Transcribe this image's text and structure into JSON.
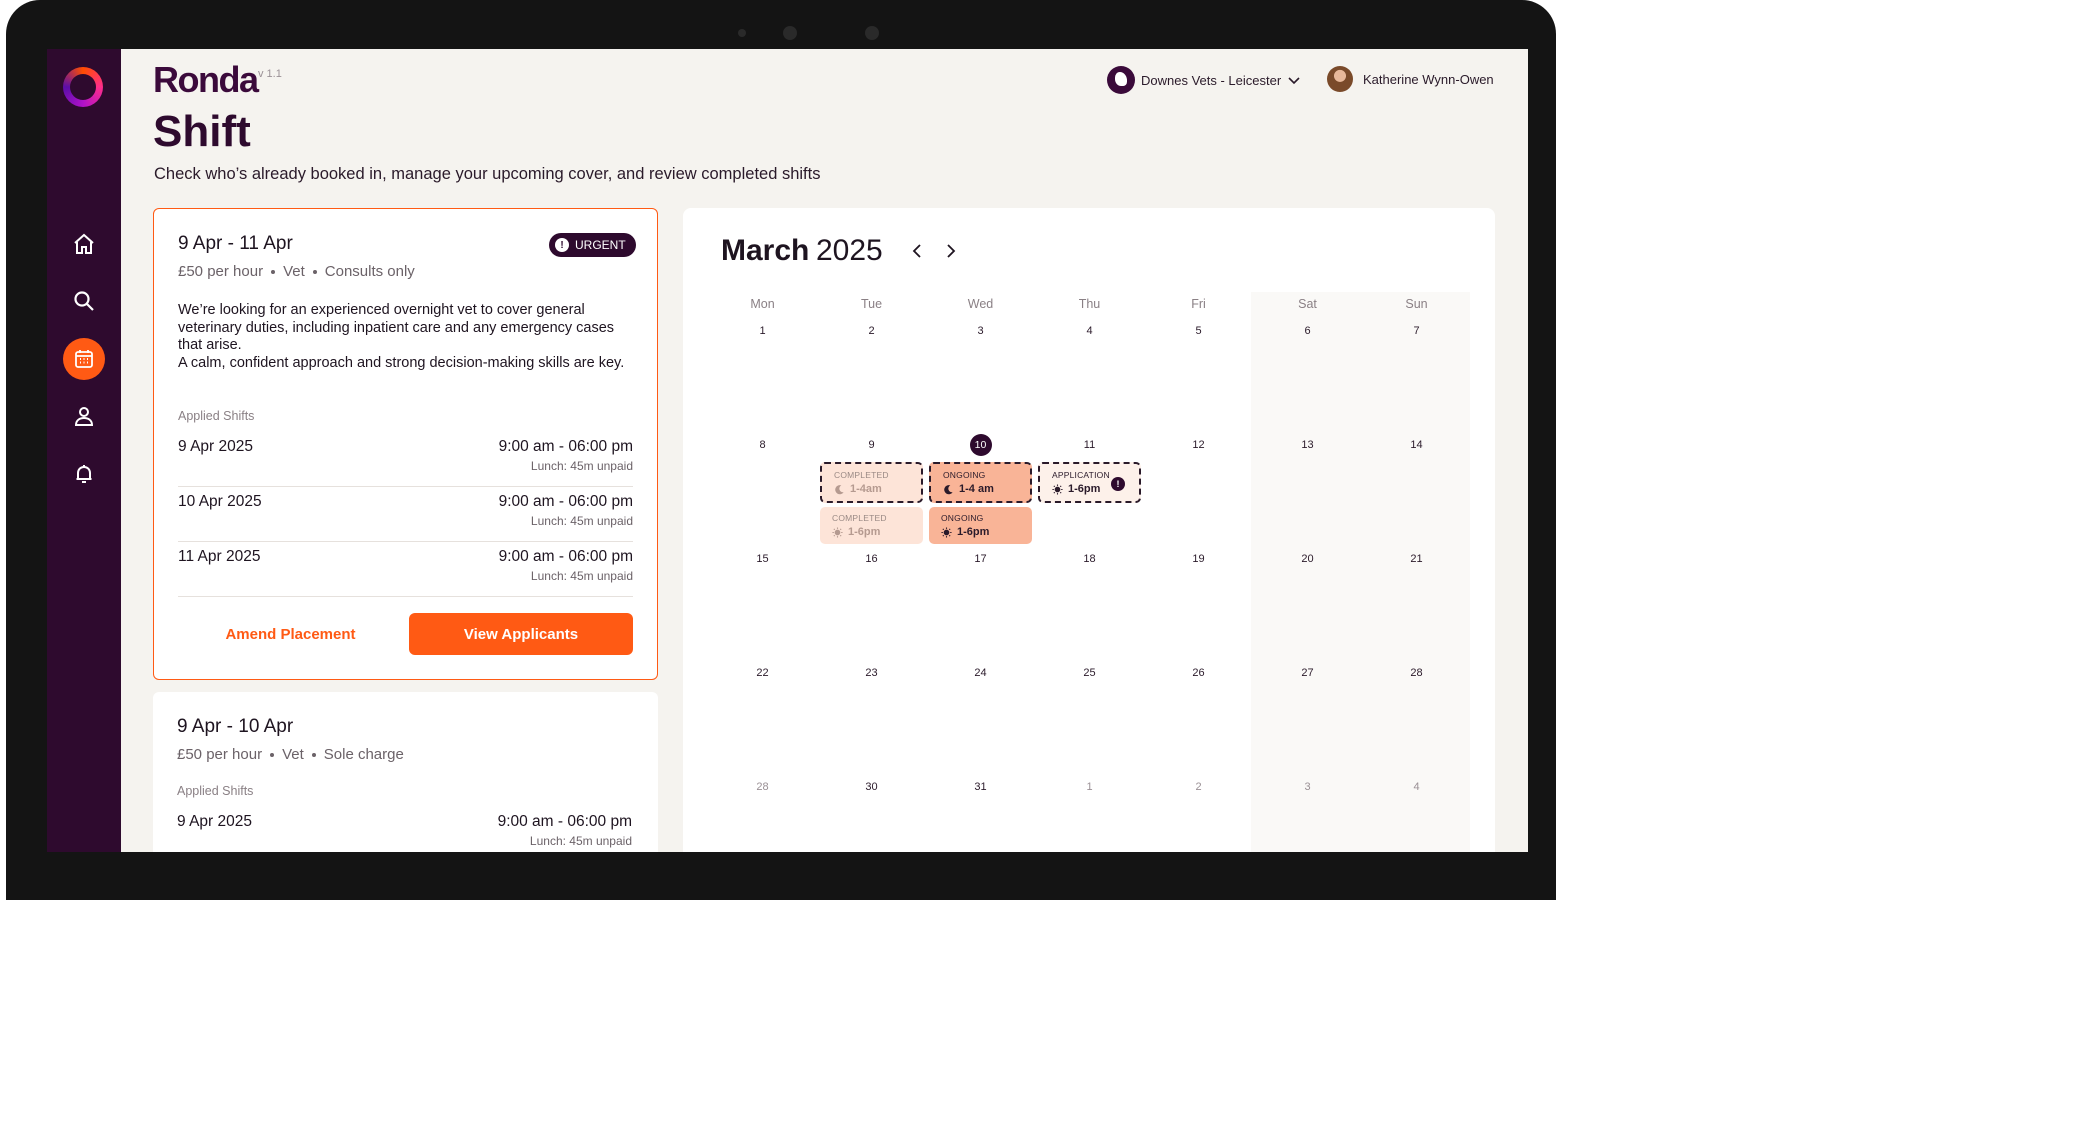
{
  "app": {
    "brand": "Ronda",
    "version": "v 1.1"
  },
  "header": {
    "org_name": "Downes Vets - Leicester",
    "user_name": "Katherine Wynn-Owen"
  },
  "page": {
    "title": "Shift",
    "subtitle": "Check who’s already booked in, manage your upcoming cover, and review completed shifts"
  },
  "sidebar": {
    "items": [
      {
        "icon": "home-icon",
        "active": false
      },
      {
        "icon": "search-icon",
        "active": false
      },
      {
        "icon": "calendar-icon",
        "active": true
      },
      {
        "icon": "user-icon",
        "active": false
      },
      {
        "icon": "bell-icon",
        "active": false
      }
    ]
  },
  "shifts": [
    {
      "title": "9 Apr - 11 Apr",
      "rate": "£50 per hour",
      "role": "Vet",
      "type": "Consults only",
      "badge": "URGENT",
      "description": "We’re looking for an experienced overnight vet to cover general veterinary duties, including inpatient care and any emergency cases that arise.\nA calm, confident approach and strong decision-making skills are key.",
      "applied_label": "Applied Shifts",
      "rows": [
        {
          "date": "9 Apr 2025",
          "time": "9:00 am - 06:00 pm",
          "lunch": "Lunch: 45m unpaid"
        },
        {
          "date": "10 Apr 2025",
          "time": "9:00 am - 06:00 pm",
          "lunch": "Lunch: 45m unpaid"
        },
        {
          "date": "11 Apr 2025",
          "time": "9:00 am - 06:00 pm",
          "lunch": "Lunch: 45m unpaid"
        }
      ],
      "amend_label": "Amend Placement",
      "view_label": "View Applicants"
    },
    {
      "title": "9 Apr - 10 Apr",
      "rate": "£50 per hour",
      "role": "Vet",
      "type": "Sole charge",
      "applied_label": "Applied Shifts",
      "rows": [
        {
          "date": "9 Apr 2025",
          "time": "9:00 am - 06:00 pm",
          "lunch": "Lunch: 45m unpaid"
        }
      ]
    }
  ],
  "calendar": {
    "month": "March",
    "year": "2025",
    "weekdays": [
      "Mon",
      "Tue",
      "Wed",
      "Thu",
      "Fri",
      "Sat",
      "Sun"
    ],
    "weeks": [
      [
        "1",
        "2",
        "3",
        "4",
        "5",
        "6",
        "7"
      ],
      [
        "8",
        "9",
        "10",
        "11",
        "12",
        "13",
        "14"
      ],
      [
        "15",
        "16",
        "17",
        "18",
        "19",
        "20",
        "21"
      ],
      [
        "22",
        "23",
        "24",
        "25",
        "26",
        "27",
        "28"
      ],
      [
        "28",
        "30",
        "31",
        "1",
        "2",
        "3",
        "4"
      ]
    ],
    "today": "10",
    "events": [
      {
        "status": "COMPLETED",
        "time": "1-4am",
        "icon": "moon-icon"
      },
      {
        "status": "ONGOING",
        "time": "1-4 am",
        "icon": "moon-icon"
      },
      {
        "status": "APPLICATION",
        "time": "1-6pm",
        "icon": "sun-icon"
      },
      {
        "status": "COMPLETED",
        "time": "1-6pm",
        "icon": "sun-icon"
      },
      {
        "status": "ONGOING",
        "time": "1-6pm",
        "icon": "sun-icon"
      }
    ]
  },
  "colors": {
    "accent": "#ff5a14",
    "brand": "#2e0a2e",
    "sidebar": "#2e0a2e"
  }
}
